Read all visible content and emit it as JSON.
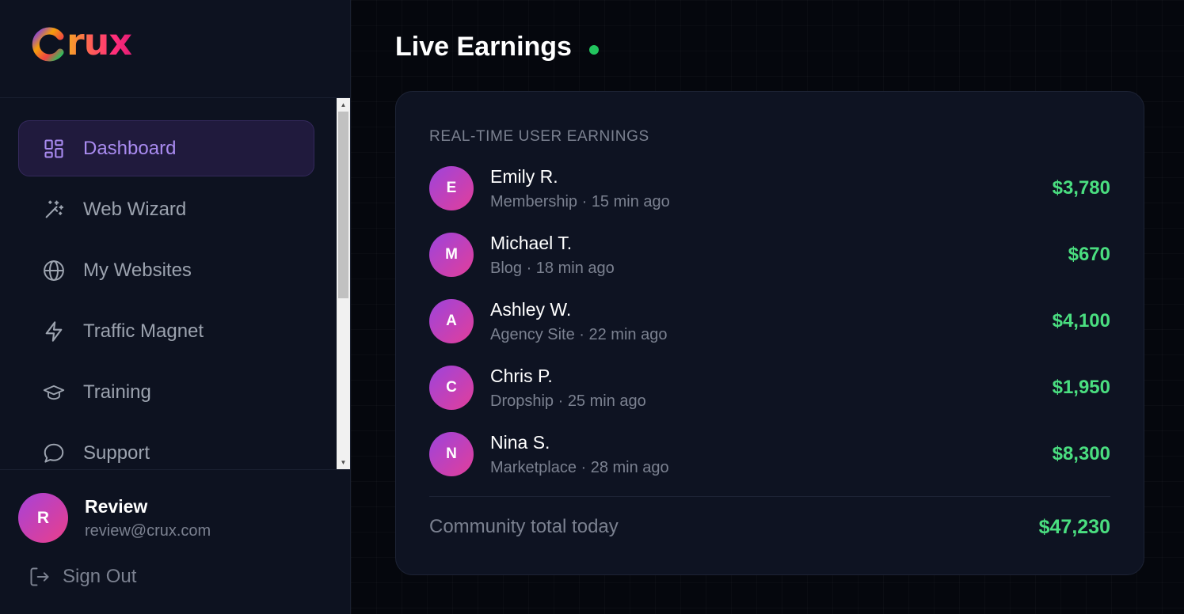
{
  "brand": {
    "name": "crux"
  },
  "sidebar": {
    "items": [
      {
        "label": "Dashboard",
        "icon": "dashboard-grid-icon",
        "active": true
      },
      {
        "label": "Web Wizard",
        "icon": "magic-wand-icon",
        "active": false
      },
      {
        "label": "My Websites",
        "icon": "globe-icon",
        "active": false
      },
      {
        "label": "Traffic Magnet",
        "icon": "lightning-icon",
        "active": false
      },
      {
        "label": "Training",
        "icon": "graduation-cap-icon",
        "active": false
      },
      {
        "label": "Support",
        "icon": "chat-bubble-icon",
        "active": false
      }
    ],
    "user": {
      "initial": "R",
      "name": "Review",
      "email": "review@crux.com"
    },
    "signout_label": "Sign Out"
  },
  "main": {
    "title": "Live Earnings",
    "card_title": "REAL-TIME USER EARNINGS",
    "earnings": [
      {
        "initial": "E",
        "name": "Emily R.",
        "meta": "Membership · 15 min ago",
        "amount": "$3,780"
      },
      {
        "initial": "M",
        "name": "Michael T.",
        "meta": "Blog · 18 min ago",
        "amount": "$670"
      },
      {
        "initial": "A",
        "name": "Ashley W.",
        "meta": "Agency Site · 22 min ago",
        "amount": "$4,100"
      },
      {
        "initial": "C",
        "name": "Chris P.",
        "meta": "Dropship · 25 min ago",
        "amount": "$1,950"
      },
      {
        "initial": "N",
        "name": "Nina S.",
        "meta": "Marketplace · 28 min ago",
        "amount": "$8,300"
      }
    ],
    "total_label": "Community total today",
    "total_value": "$47,230"
  },
  "colors": {
    "accent_purple": "#a98bf0",
    "success_green": "#4ade80",
    "live_dot": "#22c55e"
  }
}
